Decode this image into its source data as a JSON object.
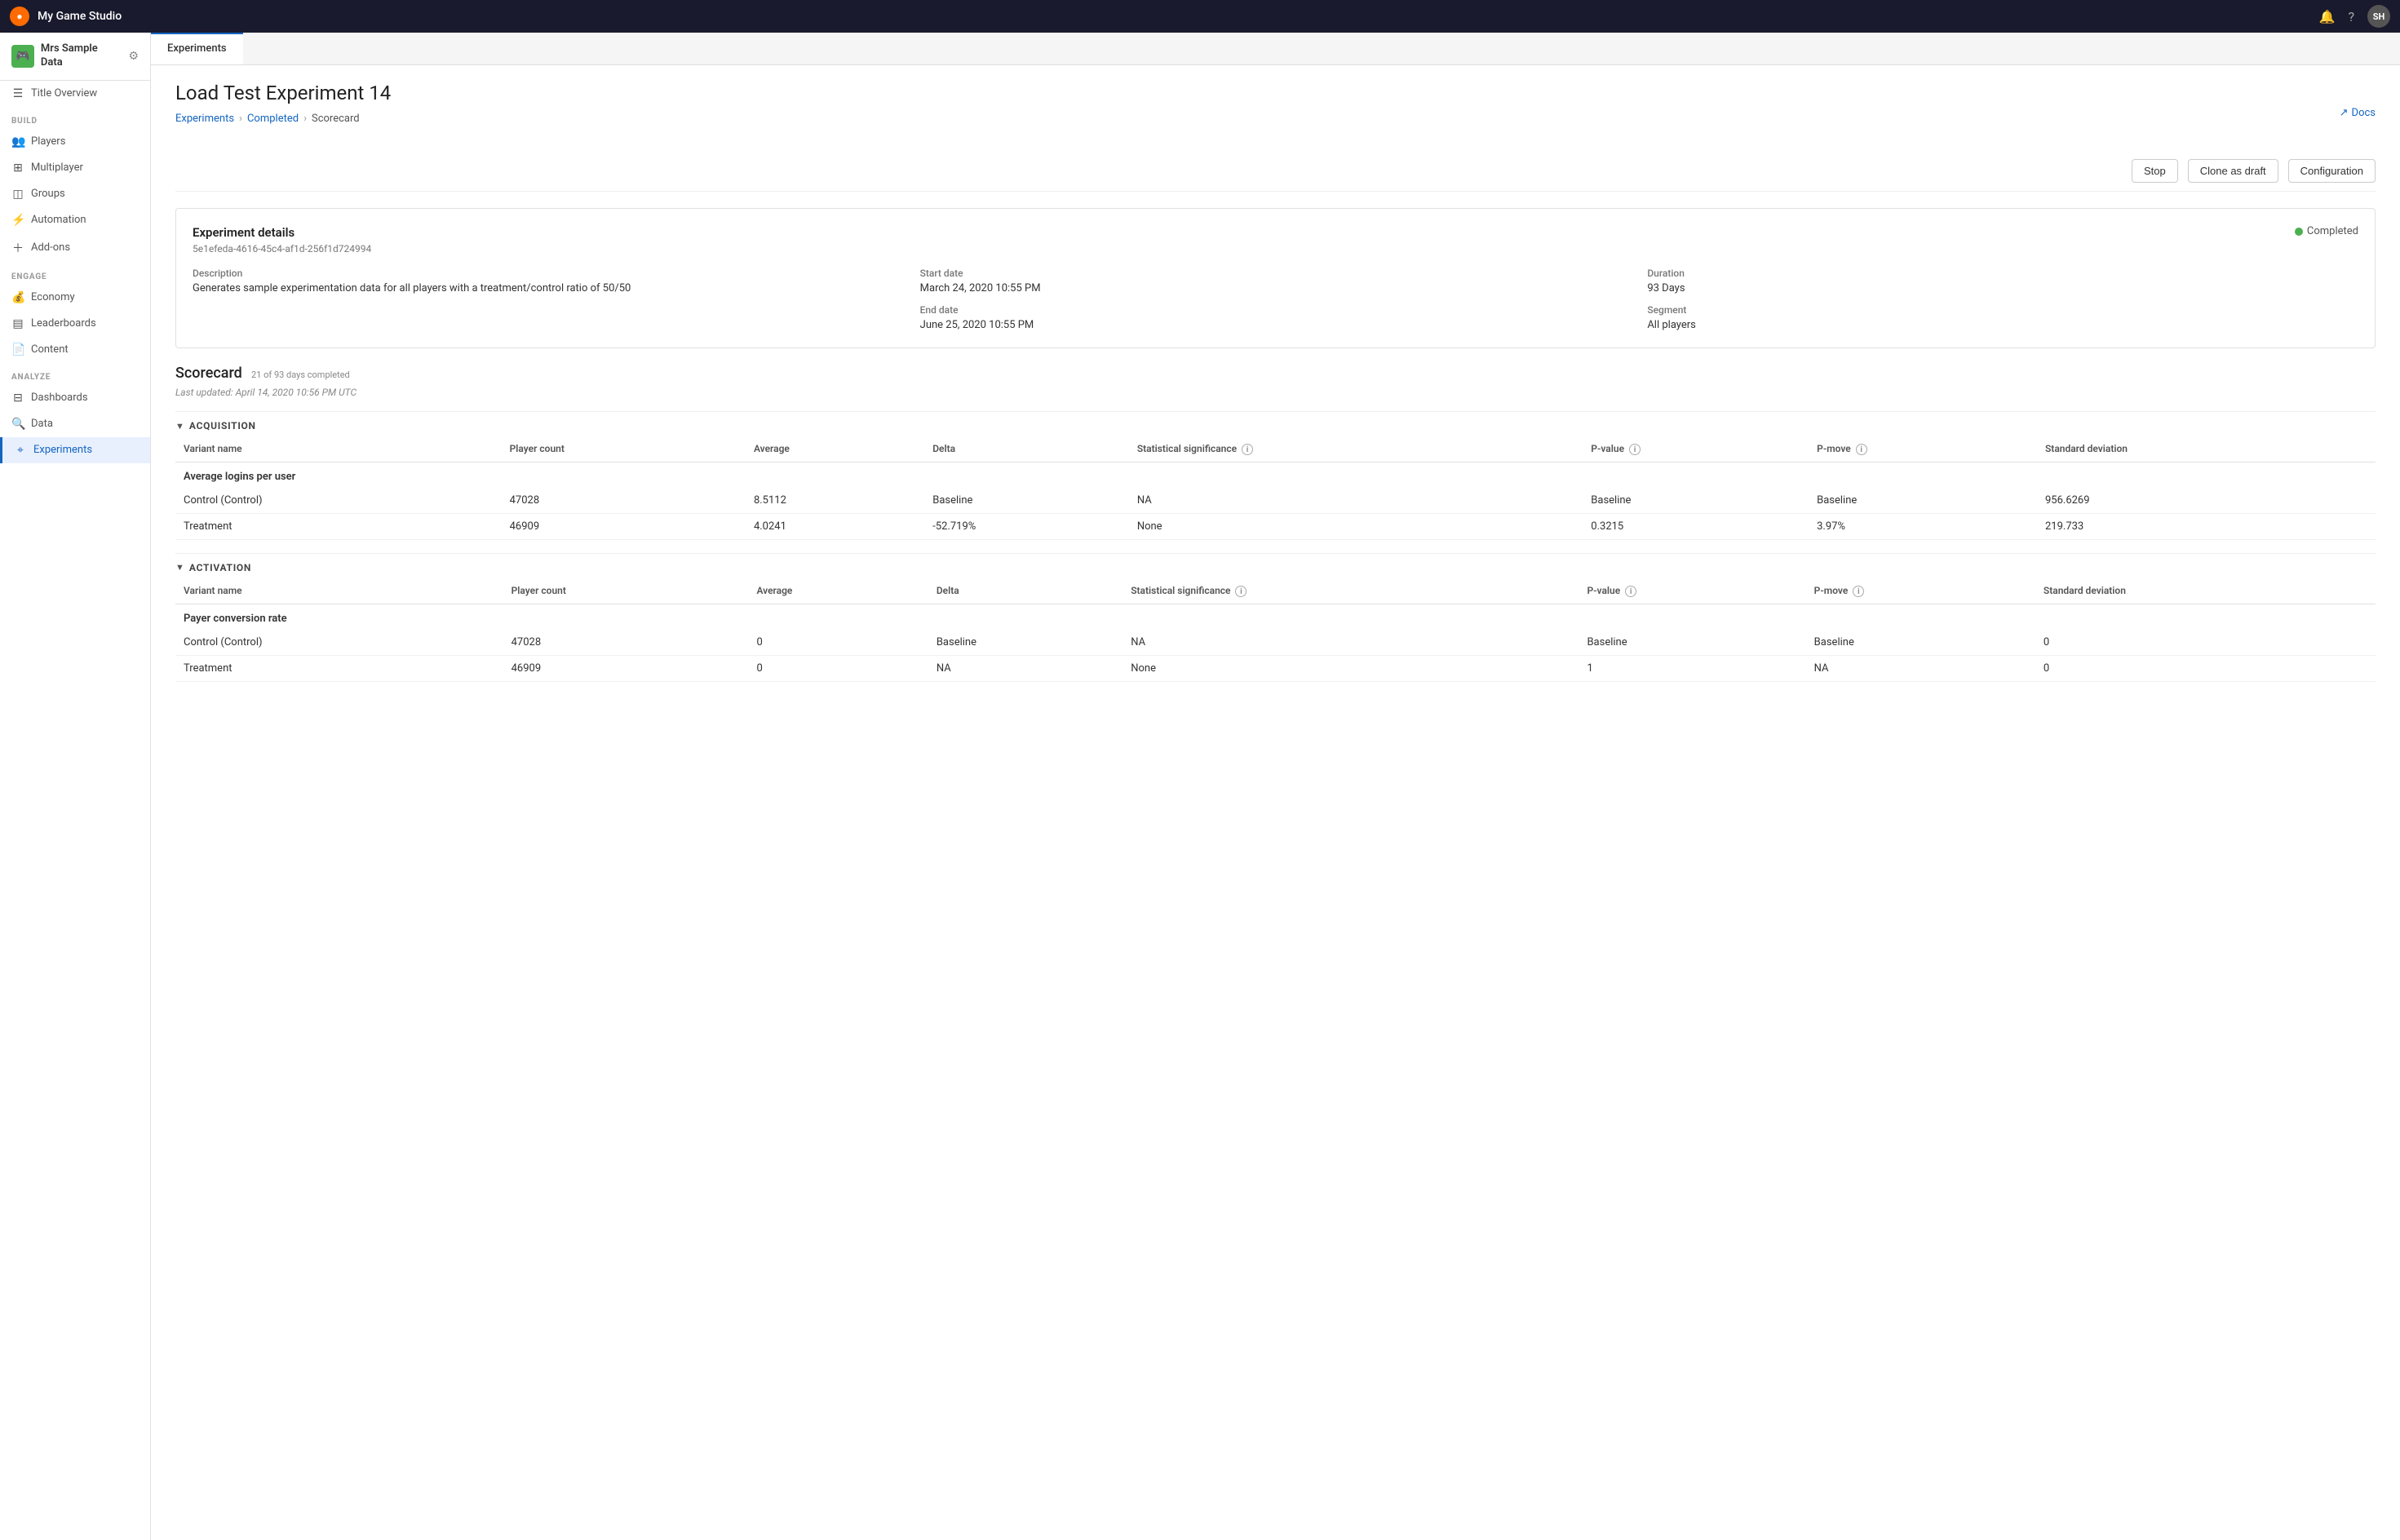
{
  "topbar": {
    "studio_name": "My Game Studio",
    "avatar_initials": "SH"
  },
  "sidebar": {
    "account_name": "Mrs Sample Data",
    "account_logo": "🎮",
    "nav_title_overview": "Title Overview",
    "section_build": "BUILD",
    "section_engage": "ENGAGE",
    "section_analyze": "ANALYZE",
    "nav_players": "Players",
    "nav_multiplayer": "Multiplayer",
    "nav_groups": "Groups",
    "nav_automation": "Automation",
    "nav_addons": "Add-ons",
    "nav_economy": "Economy",
    "nav_leaderboards": "Leaderboards",
    "nav_content": "Content",
    "nav_dashboards": "Dashboards",
    "nav_data": "Data",
    "nav_experiments": "Experiments"
  },
  "tab": {
    "label": "Experiments"
  },
  "page": {
    "title": "Load Test Experiment 14",
    "breadcrumb_experiments": "Experiments",
    "breadcrumb_completed": "Completed",
    "breadcrumb_current": "Scorecard",
    "docs_label": "Docs"
  },
  "actions": {
    "stop_label": "Stop",
    "clone_label": "Clone as draft",
    "config_label": "Configuration"
  },
  "experiment_details": {
    "card_title": "Experiment details",
    "experiment_id": "5e1efeda-4616-45c4-af1d-256f1d724994",
    "status": "Completed",
    "description_label": "Description",
    "description_value": "Generates sample experimentation data for all players with a treatment/control ratio of 50/50",
    "start_date_label": "Start date",
    "start_date_value": "March 24, 2020 10:55 PM",
    "end_date_label": "End date",
    "end_date_value": "June 25, 2020 10:55 PM",
    "duration_label": "Duration",
    "duration_value": "93 Days",
    "segment_label": "Segment",
    "segment_value": "All players"
  },
  "scorecard": {
    "title": "Scorecard",
    "days_info": "21 of 93 days completed",
    "last_updated": "Last updated: April 14, 2020 10:56 PM UTC",
    "acquisition_section": "ACQUISITION",
    "activation_section": "ACTIVATION",
    "col_variant": "Variant name",
    "col_player_count": "Player count",
    "col_average": "Average",
    "col_delta": "Delta",
    "col_stat_sig": "Statistical significance",
    "col_pvalue": "P-value",
    "col_pmove": "P-move",
    "col_std_dev": "Standard deviation",
    "acquisition_metric": "Average logins per user",
    "acquisition_rows": [
      {
        "variant": "Control (Control)",
        "player_count": "47028",
        "average": "8.5112",
        "delta": "Baseline",
        "stat_sig": "NA",
        "pvalue": "Baseline",
        "pmove": "Baseline",
        "std_dev": "956.6269"
      },
      {
        "variant": "Treatment",
        "player_count": "46909",
        "average": "4.0241",
        "delta": "-52.719%",
        "stat_sig": "None",
        "pvalue": "0.3215",
        "pmove": "3.97%",
        "std_dev": "219.733"
      }
    ],
    "activation_metric": "Payer conversion rate",
    "activation_rows": [
      {
        "variant": "Control (Control)",
        "player_count": "47028",
        "average": "0",
        "delta": "Baseline",
        "stat_sig": "NA",
        "pvalue": "Baseline",
        "pmove": "Baseline",
        "std_dev": "0"
      },
      {
        "variant": "Treatment",
        "player_count": "46909",
        "average": "0",
        "delta": "NA",
        "stat_sig": "None",
        "pvalue": "1",
        "pmove": "NA",
        "std_dev": "0"
      }
    ]
  }
}
